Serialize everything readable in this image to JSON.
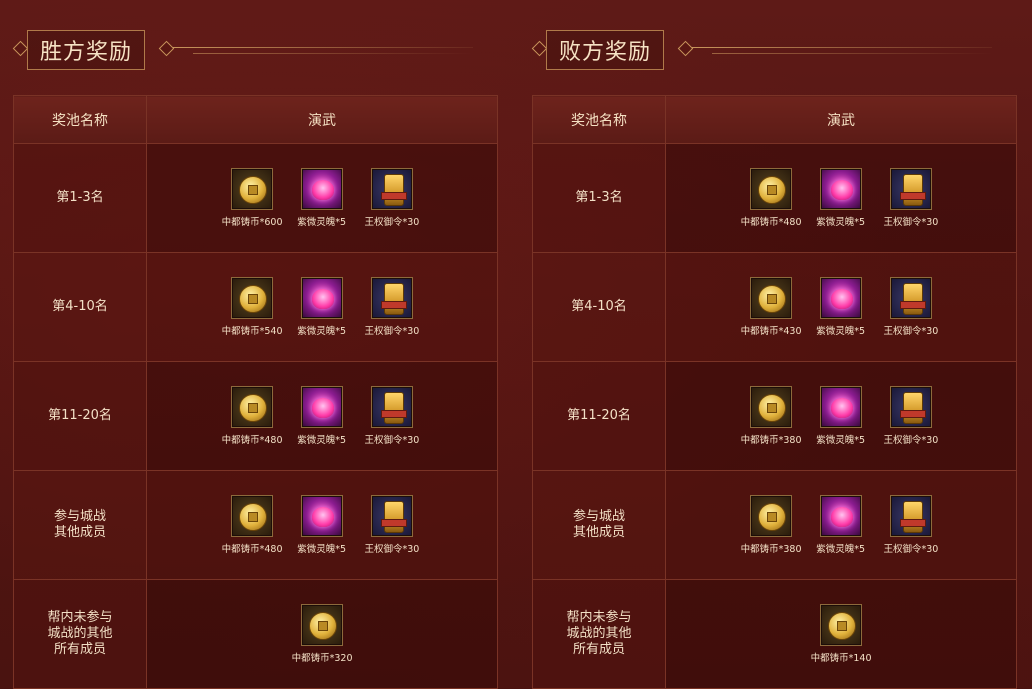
{
  "winner": {
    "title": "胜方奖励",
    "headers": {
      "name": "奖池名称",
      "pool": "演武"
    },
    "rows": [
      {
        "name": "第1-3名",
        "items": [
          {
            "icon": "coin",
            "label": "中都铸币*600"
          },
          {
            "icon": "soul",
            "label": "紫微灵魄*5"
          },
          {
            "icon": "token",
            "label": "王权御令*30"
          }
        ]
      },
      {
        "name": "第4-10名",
        "items": [
          {
            "icon": "coin",
            "label": "中都铸币*540"
          },
          {
            "icon": "soul",
            "label": "紫微灵魄*5"
          },
          {
            "icon": "token",
            "label": "王权御令*30"
          }
        ]
      },
      {
        "name": "第11-20名",
        "items": [
          {
            "icon": "coin",
            "label": "中都铸币*480"
          },
          {
            "icon": "soul",
            "label": "紫微灵魄*5"
          },
          {
            "icon": "token",
            "label": "王权御令*30"
          }
        ]
      },
      {
        "name": "参与城战\n其他成员",
        "items": [
          {
            "icon": "coin",
            "label": "中都铸币*480"
          },
          {
            "icon": "soul",
            "label": "紫微灵魄*5"
          },
          {
            "icon": "token",
            "label": "王权御令*30"
          }
        ]
      },
      {
        "name": "帮内未参与\n城战的其他\n所有成员",
        "items": [
          {
            "icon": "coin",
            "label": "中都铸币*320"
          }
        ]
      }
    ]
  },
  "loser": {
    "title": "败方奖励",
    "headers": {
      "name": "奖池名称",
      "pool": "演武"
    },
    "rows": [
      {
        "name": "第1-3名",
        "items": [
          {
            "icon": "coin",
            "label": "中都铸币*480"
          },
          {
            "icon": "soul",
            "label": "紫微灵魄*5"
          },
          {
            "icon": "token",
            "label": "王权御令*30"
          }
        ]
      },
      {
        "name": "第4-10名",
        "items": [
          {
            "icon": "coin",
            "label": "中都铸币*430"
          },
          {
            "icon": "soul",
            "label": "紫微灵魄*5"
          },
          {
            "icon": "token",
            "label": "王权御令*30"
          }
        ]
      },
      {
        "name": "第11-20名",
        "items": [
          {
            "icon": "coin",
            "label": "中都铸币*380"
          },
          {
            "icon": "soul",
            "label": "紫微灵魄*5"
          },
          {
            "icon": "token",
            "label": "王权御令*30"
          }
        ]
      },
      {
        "name": "参与城战\n其他成员",
        "items": [
          {
            "icon": "coin",
            "label": "中都铸币*380"
          },
          {
            "icon": "soul",
            "label": "紫微灵魄*5"
          },
          {
            "icon": "token",
            "label": "王权御令*30"
          }
        ]
      },
      {
        "name": "帮内未参与\n城战的其他\n所有成员",
        "items": [
          {
            "icon": "coin",
            "label": "中都铸币*140"
          }
        ]
      }
    ]
  },
  "colors": {
    "accent": "#c8955c",
    "background": "#521512",
    "text": "#f3e0c6"
  }
}
